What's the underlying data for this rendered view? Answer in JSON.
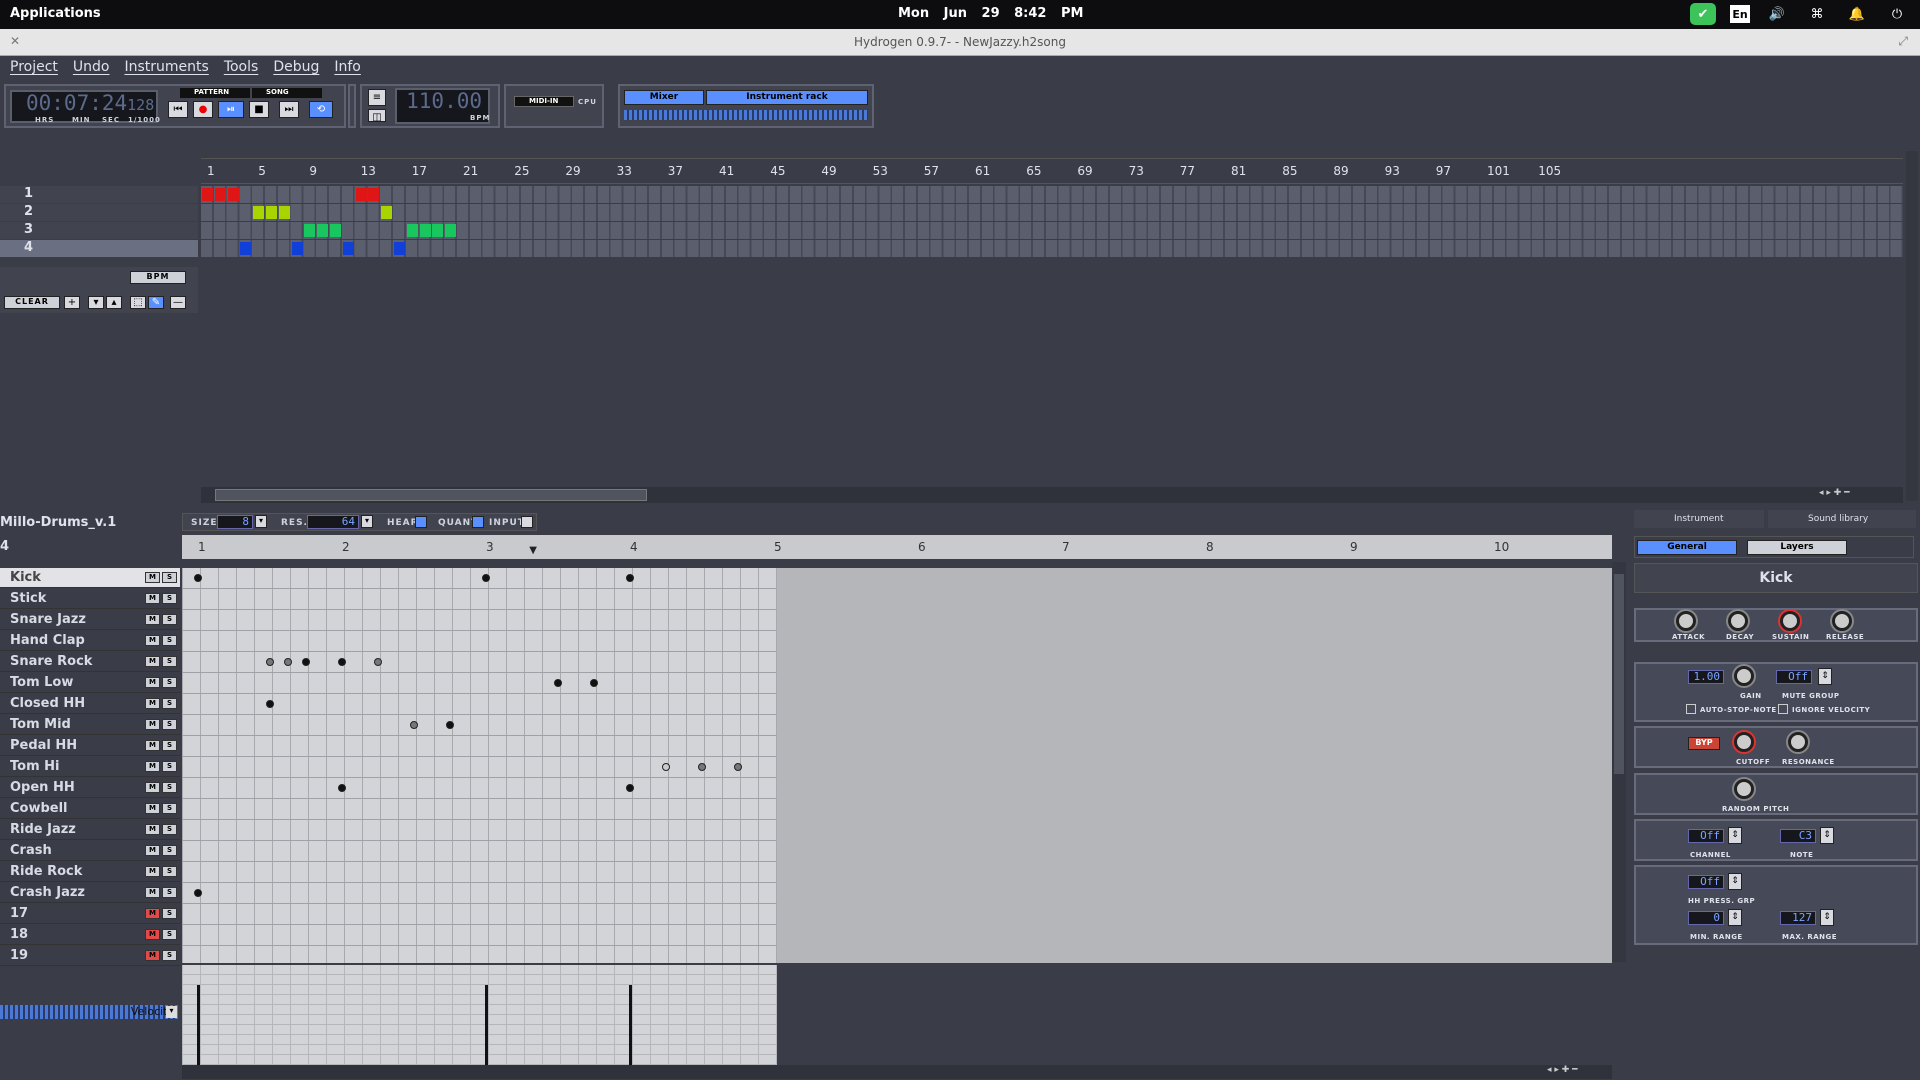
{
  "system_bar": {
    "applications": "Applications",
    "clock": "Mon Jun 29   8:42 PM",
    "keyboard": "En"
  },
  "window": {
    "title": "Hydrogen 0.9.7- - NewJazzy.h2song"
  },
  "menu": [
    "Project",
    "Undo",
    "Instruments",
    "Tools",
    "Debug",
    "Info"
  ],
  "transport": {
    "time": "00:07:24",
    "time_ms": "128",
    "time_units": [
      "HRS",
      "MIN",
      "SEC",
      "1/1000"
    ],
    "mode_pattern": "PATTERN",
    "mode_song": "SONG",
    "bpm": "110.00",
    "bpm_label": "BPM",
    "midi_in": "MIDI-IN",
    "cpu": "CPU",
    "mixer": "Mixer",
    "instrument_rack": "Instrument rack"
  },
  "song_editor": {
    "bpm_button": "BPM",
    "clear": "CLEAR",
    "ruler": [
      "1",
      "5",
      "9",
      "13",
      "17",
      "21",
      "25",
      "29",
      "33",
      "37",
      "41",
      "45",
      "49",
      "53",
      "57",
      "61",
      "65",
      "69",
      "73",
      "77",
      "81",
      "85",
      "89",
      "93",
      "97",
      "101",
      "105"
    ],
    "patterns": [
      {
        "label": "1",
        "color": "#e01616",
        "cells": [
          0,
          1,
          2,
          12,
          13
        ]
      },
      {
        "label": "2",
        "color": "#a8d400",
        "cells": [
          4,
          5,
          6,
          14
        ]
      },
      {
        "label": "3",
        "color": "#18c75e",
        "cells": [
          8,
          9,
          10,
          16,
          17,
          18,
          19
        ]
      },
      {
        "label": "4",
        "color": "#1040d8",
        "cells": [
          3,
          7,
          11,
          15
        ]
      }
    ],
    "selected_pattern": "4"
  },
  "pattern_editor": {
    "drumkit": "Millo-Drums_v.1",
    "pattern_number": "4",
    "size_label": "SIZE",
    "size_value": "8",
    "res_label": "RES.",
    "res_value": "64",
    "hear": "HEAR",
    "quant": "QUANT",
    "input": "INPUT",
    "ruler": [
      "1",
      "2",
      "3",
      "4",
      "5",
      "6",
      "7",
      "8",
      "9",
      "10"
    ],
    "instruments": [
      {
        "name": "Kick",
        "mute_red": false
      },
      {
        "name": "Stick",
        "mute_red": false
      },
      {
        "name": "Snare Jazz",
        "mute_red": false
      },
      {
        "name": "Hand Clap",
        "mute_red": false
      },
      {
        "name": "Snare Rock",
        "mute_red": false
      },
      {
        "name": "Tom Low",
        "mute_red": false
      },
      {
        "name": "Closed HH",
        "mute_red": false
      },
      {
        "name": "Tom Mid",
        "mute_red": false
      },
      {
        "name": "Pedal HH",
        "mute_red": false
      },
      {
        "name": "Tom Hi",
        "mute_red": false
      },
      {
        "name": "Open HH",
        "mute_red": false
      },
      {
        "name": "Cowbell",
        "mute_red": false
      },
      {
        "name": "Ride Jazz",
        "mute_red": false
      },
      {
        "name": "Crash",
        "mute_red": false
      },
      {
        "name": "Ride Rock",
        "mute_red": false
      },
      {
        "name": "Crash Jazz",
        "mute_red": false
      },
      {
        "name": "17",
        "mute_red": true
      },
      {
        "name": "18",
        "mute_red": true
      },
      {
        "name": "19",
        "mute_red": true
      }
    ],
    "notes": [
      {
        "row": 0,
        "beat": 1.0,
        "v": "full"
      },
      {
        "row": 0,
        "beat": 3.0,
        "v": "full"
      },
      {
        "row": 0,
        "beat": 4.0,
        "v": "full"
      },
      {
        "row": 4,
        "beat": 1.5,
        "v": "soft"
      },
      {
        "row": 4,
        "beat": 1.625,
        "v": "soft"
      },
      {
        "row": 4,
        "beat": 1.75,
        "v": "full"
      },
      {
        "row": 4,
        "beat": 2.0,
        "v": "full"
      },
      {
        "row": 4,
        "beat": 2.25,
        "v": "soft"
      },
      {
        "row": 5,
        "beat": 3.5,
        "v": "full"
      },
      {
        "row": 5,
        "beat": 3.75,
        "v": "full"
      },
      {
        "row": 6,
        "beat": 1.5,
        "v": "full"
      },
      {
        "row": 7,
        "beat": 2.5,
        "v": "soft"
      },
      {
        "row": 7,
        "beat": 2.75,
        "v": "full"
      },
      {
        "row": 9,
        "beat": 4.25,
        "v": "ghost"
      },
      {
        "row": 9,
        "beat": 4.5,
        "v": "soft"
      },
      {
        "row": 9,
        "beat": 4.75,
        "v": "soft"
      },
      {
        "row": 10,
        "beat": 2.0,
        "v": "full"
      },
      {
        "row": 10,
        "beat": 4.0,
        "v": "full"
      },
      {
        "row": 15,
        "beat": 1.0,
        "v": "full"
      }
    ],
    "velocity_label": "Velocity",
    "velocity_bars": [
      1.0,
      3.0,
      4.0
    ]
  },
  "instrument_panel": {
    "tab_instrument": "Instrument",
    "tab_library": "Sound library",
    "tab_general": "General",
    "tab_layers": "Layers",
    "name": "Kick",
    "adsr": [
      "ATTACK",
      "DECAY",
      "SUSTAIN",
      "RELEASE"
    ],
    "gain_value": "1.00",
    "gain": "GAIN",
    "mute_group_value": "Off",
    "mute_group": "MUTE GROUP",
    "auto_stop": "AUTO-STOP-NOTE",
    "ignore_velocity": "IGNORE VELOCITY",
    "byp": "BYP",
    "cutoff": "CUTOFF",
    "resonance": "RESONANCE",
    "random_pitch": "RANDOM PITCH",
    "channel_value": "Off",
    "channel": "CHANNEL",
    "note_value": "C3",
    "note": "NOTE",
    "hh_value": "Off",
    "hh_press": "HH PRESS. GRP",
    "min_value": "0",
    "min_range": "MIN. RANGE",
    "max_value": "127",
    "max_range": "MAX. RANGE"
  }
}
